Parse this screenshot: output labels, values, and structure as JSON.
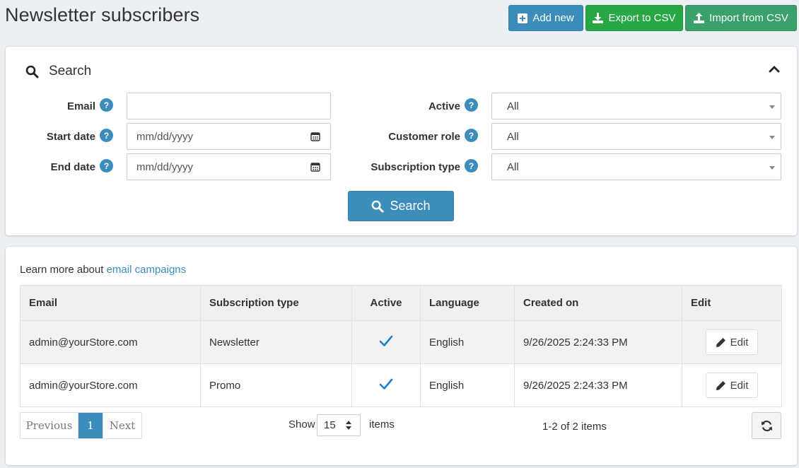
{
  "header": {
    "title": "Newsletter subscribers",
    "add_label": "Add new",
    "export_label": "Export to CSV",
    "import_label": "Import from CSV"
  },
  "search": {
    "title": "Search",
    "email_label": "Email",
    "email_value": "",
    "start_date_label": "Start date",
    "start_date_placeholder": "mm/dd/yyyy",
    "end_date_label": "End date",
    "end_date_placeholder": "mm/dd/yyyy",
    "active_label": "Active",
    "active_value": "All",
    "customer_role_label": "Customer role",
    "customer_role_value": "All",
    "subscription_type_label": "Subscription type",
    "subscription_type_value": "All",
    "help_glyph": "?",
    "button_label": "Search"
  },
  "grid": {
    "learn_prefix": "Learn more about",
    "learn_link": "email campaigns",
    "columns": [
      "Email",
      "Subscription type",
      "Active",
      "Language",
      "Created on",
      "Edit"
    ],
    "rows": [
      {
        "email": "admin@yourStore.com",
        "subscription_type": "Newsletter",
        "active": true,
        "language": "English",
        "created_on": "9/26/2025 2:24:33 PM",
        "edit_label": "Edit"
      },
      {
        "email": "admin@yourStore.com",
        "subscription_type": "Promo",
        "active": true,
        "language": "English",
        "created_on": "9/26/2025 2:24:33 PM",
        "edit_label": "Edit"
      }
    ],
    "pager": {
      "previous": "Previous",
      "current": "1",
      "next": "Next"
    },
    "show_label": "Show",
    "page_size": "15",
    "items_label": "items",
    "range_text": "1-2 of 2 items"
  },
  "colors": {
    "primary": "#3c8dbc",
    "success": "#28a745",
    "import": "#39a169",
    "check": "#1f7fc4"
  },
  "icons": [
    "plus-square-icon",
    "download-icon",
    "upload-icon",
    "search-icon",
    "chevron-up-icon",
    "help-icon",
    "calendar-icon",
    "caret-down-icon",
    "check-icon",
    "pencil-icon",
    "refresh-icon"
  ]
}
